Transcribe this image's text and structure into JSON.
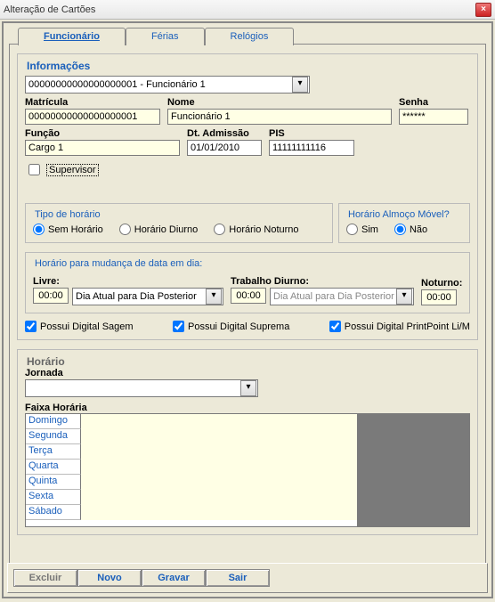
{
  "window": {
    "title": "Alteração de Cartões",
    "close": "×"
  },
  "tabs": {
    "t1": "Funcionário",
    "t2": "Férias",
    "t3": "Relógios"
  },
  "info": {
    "legend": "Informações",
    "selector": "00000000000000000001 - Funcionário 1",
    "matricula_label": "Matrícula",
    "matricula": "00000000000000000001",
    "nome_label": "Nome",
    "nome": "Funcionário 1",
    "senha_label": "Senha",
    "senha": "******",
    "funcao_label": "Função",
    "funcao": "Cargo 1",
    "admissao_label": "Dt. Admissão",
    "admissao": "01/01/2010",
    "pis_label": "PIS",
    "pis": "11111111116",
    "supervisor_label": "Supervisor"
  },
  "tipo": {
    "legend": "Tipo de horário",
    "r1": "Sem Horário",
    "r2": "Horário Diurno",
    "r3": "Horário Noturno"
  },
  "almoco": {
    "legend": "Horário Almoço Móvel?",
    "sim": "Sim",
    "nao": "Não"
  },
  "mudanca": {
    "legend": "Horário para mudança de data em dia:",
    "livre_label": "Livre:",
    "livre_time": "00:00",
    "livre_sel": "Dia Atual para Dia Posterior",
    "trab_label": "Trabalho Diurno:",
    "trab_time": "00:00",
    "trab_sel": "Dia Atual para Dia Posterior",
    "not_label": "Noturno:",
    "not_time": "00:00"
  },
  "digitals": {
    "d1": "Possui Digital Sagem",
    "d2": "Possui Digital Suprema",
    "d3": "Possui Digital PrintPoint Li/M"
  },
  "horario": {
    "legend": "Horário",
    "jornada_label": "Jornada",
    "jornada_value": "",
    "faixa_label": "Faixa Horária",
    "days": {
      "d0": "Domingo",
      "d1": "Segunda",
      "d2": "Terça",
      "d3": "Quarta",
      "d4": "Quinta",
      "d5": "Sexta",
      "d6": "Sábado"
    }
  },
  "buttons": {
    "excluir": "Excluir",
    "novo": "Novo",
    "gravar": "Gravar",
    "sair": "Sair"
  }
}
